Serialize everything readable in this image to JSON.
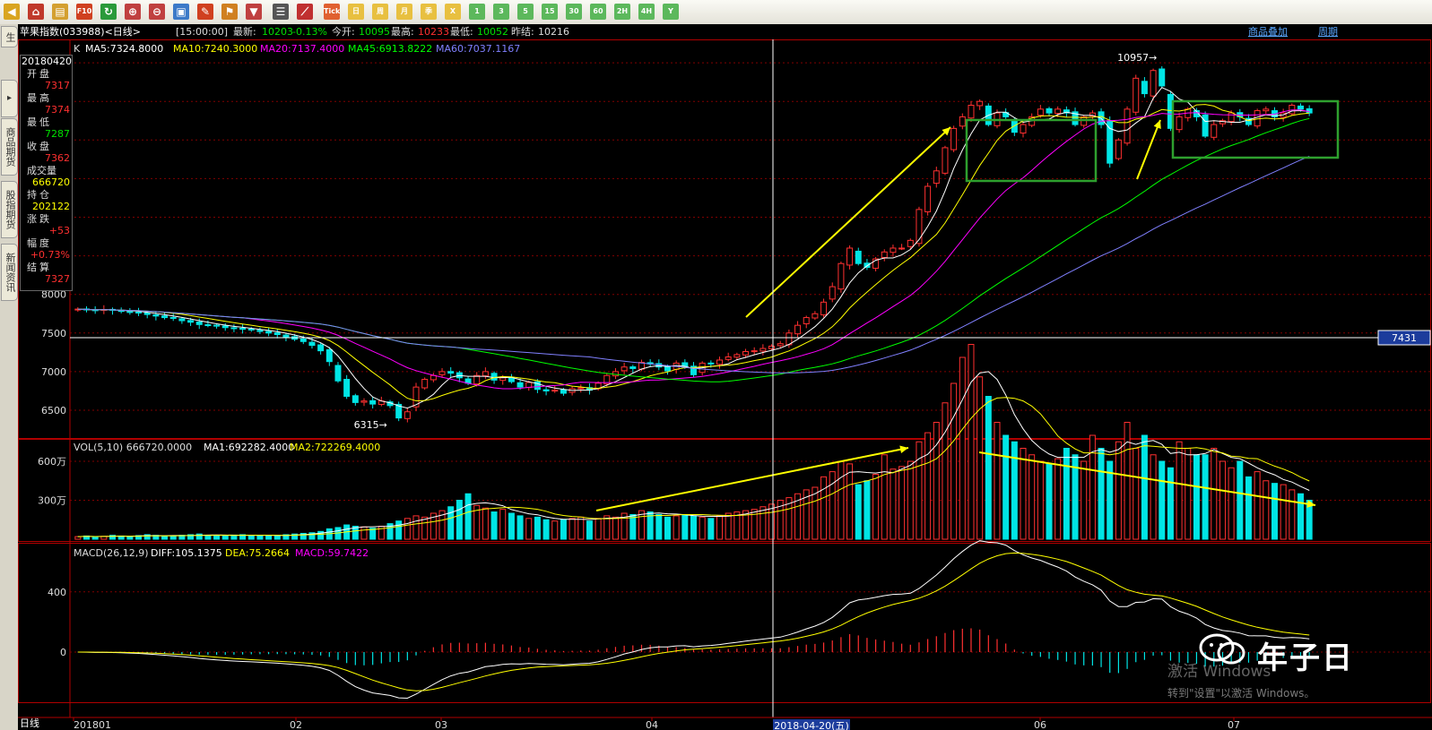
{
  "toolbar": {
    "buttons": [
      {
        "name": "back-icon",
        "label": "",
        "color": "#d9a520"
      },
      {
        "name": "home-icon",
        "label": "",
        "color": "#c0392b"
      },
      {
        "name": "book-icon",
        "label": "",
        "color": "#d4a030"
      },
      {
        "name": "f10-icon",
        "label": "F10",
        "color": "#d04020"
      },
      {
        "name": "refresh-icon",
        "label": "",
        "color": "#2a9a3a"
      },
      {
        "name": "zoom-in-icon",
        "label": "",
        "color": "#c04040"
      },
      {
        "name": "zoom-out-icon",
        "label": "",
        "color": "#c04040"
      },
      {
        "name": "window-icon",
        "label": "",
        "color": "#3c7ac8"
      },
      {
        "name": "pen-icon",
        "label": "",
        "color": "#d04020"
      },
      {
        "name": "alert-icon",
        "label": "",
        "color": "#d08020"
      },
      {
        "name": "filter-icon",
        "label": "",
        "color": "#c04040"
      },
      {
        "name": "list-icon",
        "label": "",
        "color": "#555555"
      },
      {
        "name": "line-chart-icon",
        "label": "",
        "color": "#c03030"
      },
      {
        "name": "tick-button",
        "label": "Tick",
        "color": "#e06030"
      },
      {
        "name": "period-day-button",
        "label": "日",
        "color": "#e8c040"
      },
      {
        "name": "period-week-button",
        "label": "周",
        "color": "#e8c040"
      },
      {
        "name": "period-month-button",
        "label": "月",
        "color": "#e8c040"
      },
      {
        "name": "period-quarter-button",
        "label": "季",
        "color": "#e8c040"
      },
      {
        "name": "period-year-button",
        "label": "X",
        "color": "#e8c040"
      },
      {
        "name": "period-1min-button",
        "label": "1",
        "color": "#5cb85c"
      },
      {
        "name": "period-3min-button",
        "label": "3",
        "color": "#5cb85c"
      },
      {
        "name": "period-5min-button",
        "label": "5",
        "color": "#5cb85c"
      },
      {
        "name": "period-15min-button",
        "label": "15",
        "color": "#5cb85c"
      },
      {
        "name": "period-30min-button",
        "label": "30",
        "color": "#5cb85c"
      },
      {
        "name": "period-60min-button",
        "label": "60",
        "color": "#5cb85c"
      },
      {
        "name": "period-2h-button",
        "label": "2H",
        "color": "#5cb85c"
      },
      {
        "name": "period-4h-button",
        "label": "4H",
        "color": "#5cb85c"
      },
      {
        "name": "period-custom-button",
        "label": "Y",
        "color": "#5cb85c"
      }
    ]
  },
  "sidebar": {
    "tabs": [
      {
        "label": "生"
      },
      {
        "label": "商品期货"
      },
      {
        "label": "股指期货"
      },
      {
        "label": "新闻资讯"
      }
    ]
  },
  "infobar": {
    "symbol": "苹果指数(033988)<日线>",
    "time": "[15:00:00]",
    "last_label": "最新:",
    "last": "10203",
    "change": "-0.13%",
    "open_label": "今开:",
    "open": "10095",
    "high_label": "最高:",
    "high": "10233",
    "low_label": "最低:",
    "low": "10052",
    "prev_label": "昨结:",
    "prev": "10216",
    "overlay_link": "商品叠加",
    "period_link": "周期"
  },
  "quote": {
    "date": "20180420",
    "open_label": "开盘",
    "open": "7317",
    "high_label": "最高",
    "high": "7374",
    "low_label": "最低",
    "low": "7287",
    "close_label": "收盘",
    "close": "7362",
    "volume_label": "成交量",
    "volume": "666720",
    "oi_label": "持仓",
    "oi": "202122",
    "change_label": "涨跌",
    "change": "+53",
    "pct_label": "幅度",
    "pct": "+0.73%",
    "settle_label": "结算",
    "settle": "7327"
  },
  "colors": {
    "up": "#ff3030",
    "down": "#00e5e5",
    "ma5": "#ffffff",
    "ma10": "#ffff00",
    "ma20": "#ff00ff",
    "ma45": "#00ff00",
    "ma60": "#8080ff",
    "grid": "#800000",
    "annotation": "#ffff00",
    "box": "#2ea02e"
  },
  "chart_data": {
    "type": "candlestick",
    "title": "苹果指数(033988)<日线>",
    "period_label": "日线",
    "x_tick_labels": [
      "201801",
      "02",
      "03",
      "04",
      "06",
      "07"
    ],
    "crosshair_date": "2018-04-20(五)",
    "crosshair_price": "7431",
    "price_axis": {
      "ticks": [
        6500,
        7000,
        7500,
        8000
      ]
    },
    "price_annotations": [
      {
        "label": "10957",
        "value": 10957
      },
      {
        "label": "6315",
        "value": 6315
      }
    ],
    "ma_legend": {
      "k": "K",
      "ma5": "MA5:7324.8000",
      "ma10": "MA10:7240.3000",
      "ma20": "MA20:7137.4000",
      "ma45": "MA45:6913.8222",
      "ma60": "MA60:7037.1167"
    },
    "volume_legend": {
      "vol": "VOL(5,10) 666720.0000",
      "ma1": "MA1:692282.4000",
      "ma2": "MA2:722269.4000"
    },
    "volume_axis": {
      "ticks": [
        {
          "label": "600万",
          "value": 6000000
        },
        {
          "label": "300万",
          "value": 3000000
        }
      ]
    },
    "macd_legend": {
      "name": "MACD(26,12,9)",
      "diff": "DIFF:105.1375",
      "dea": "DEA:75.2664",
      "macd": "MACD:59.7422"
    },
    "macd_axis": {
      "ticks": [
        400,
        0
      ]
    },
    "closes": [
      7810,
      7800,
      7790,
      7805,
      7795,
      7780,
      7770,
      7760,
      7740,
      7720,
      7700,
      7690,
      7660,
      7640,
      7610,
      7600,
      7590,
      7570,
      7560,
      7550,
      7540,
      7520,
      7500,
      7480,
      7450,
      7420,
      7390,
      7340,
      7270,
      7130,
      6880,
      6680,
      6600,
      6620,
      6580,
      6620,
      6560,
      6400,
      6480,
      6800,
      6900,
      6950,
      7000,
      6980,
      6920,
      6850,
      6950,
      7000,
      6890,
      6920,
      6870,
      6800,
      6860,
      6770,
      6750,
      6760,
      6720,
      6780,
      6790,
      6760,
      6850,
      6950,
      7000,
      7060,
      7040,
      7120,
      7100,
      7060,
      7010,
      7110,
      7060,
      6960,
      7110,
      7100,
      7150,
      7190,
      7220,
      7260,
      7270,
      7300,
      7330,
      7362,
      7500,
      7600,
      7700,
      7750,
      7900,
      8100,
      8400,
      8600,
      8400,
      8350,
      8460,
      8550,
      8600,
      8600,
      8700,
      9100,
      9400,
      9600,
      9900,
      10150,
      10300,
      10450,
      10500,
      10200,
      10350,
      10300,
      10100,
      10200,
      10300,
      10400,
      10350,
      10400,
      10350,
      10200,
      10300,
      10350,
      10200,
      9700,
      10000,
      10400,
      10800,
      10600,
      10900,
      10700,
      10150,
      10300,
      10400,
      10300,
      10050,
      10200,
      10250,
      10350,
      10300,
      10200,
      10380,
      10400,
      10300,
      10350,
      10450,
      10400,
      10350
    ],
    "volumes": [
      20,
      25,
      18,
      22,
      30,
      25,
      20,
      28,
      35,
      30,
      22,
      26,
      30,
      35,
      40,
      28,
      30,
      25,
      32,
      35,
      30,
      28,
      26,
      30,
      35,
      40,
      45,
      50,
      60,
      80,
      90,
      110,
      100,
      95,
      85,
      100,
      120,
      140,
      160,
      180,
      170,
      200,
      220,
      250,
      300,
      350,
      260,
      240,
      210,
      230,
      200,
      180,
      160,
      170,
      150,
      140,
      150,
      160,
      170,
      140,
      160,
      180,
      170,
      200,
      190,
      220,
      210,
      190,
      170,
      180,
      190,
      180,
      170,
      160,
      180,
      200,
      210,
      220,
      230,
      250,
      270,
      300,
      320,
      350,
      380,
      400,
      480,
      520,
      600,
      580,
      420,
      450,
      500,
      650,
      540,
      560,
      600,
      750,
      820,
      900,
      1050,
      1200,
      1400,
      1500,
      1250,
      1100,
      900,
      800,
      750,
      700,
      650,
      600,
      580,
      620,
      700,
      650,
      600,
      800,
      700,
      600,
      750,
      900,
      700,
      800,
      650,
      600,
      550,
      750,
      700,
      650,
      650,
      700,
      600,
      550,
      600,
      480,
      520,
      450,
      430,
      420,
      380,
      350,
      300
    ]
  }
}
